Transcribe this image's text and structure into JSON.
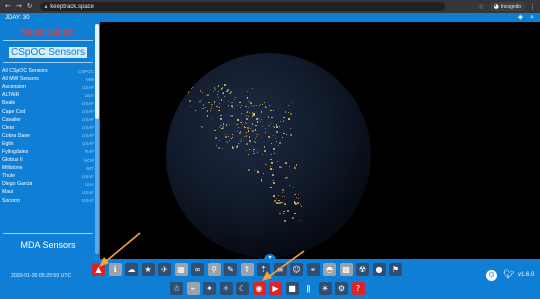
{
  "browser": {
    "url": "keeptrack.space",
    "incognito_label": "Incognito",
    "icons": {
      "back": "back-arrow-icon",
      "forward": "forward-arrow-icon",
      "reload": "reload-icon",
      "lock": "lock-icon",
      "bookmark": "star-icon",
      "incognito": "incognito-icon",
      "menu": "more-vert-icon"
    }
  },
  "topbar": {
    "jday": "JDAY: 30",
    "icons": [
      "layers-icon",
      "search-icon"
    ]
  },
  "panel": {
    "reset_label": "Reset Sensor",
    "cspoc_title": "CSpOC Sensors",
    "mda_title": "MDA Sensors",
    "sensors": [
      {
        "name": "All CSpOC Sensors",
        "code": "CSPOC"
      },
      {
        "name": "All MW Sensors",
        "code": "MW"
      },
      {
        "name": "Ascension",
        "code": "USAF"
      },
      {
        "name": "ALTAIR",
        "code": "USA"
      },
      {
        "name": "Beale",
        "code": "USAF"
      },
      {
        "name": "Cape Cod",
        "code": "USAF"
      },
      {
        "name": "Cavalier",
        "code": "USAF"
      },
      {
        "name": "Clear",
        "code": "USAF"
      },
      {
        "name": "Cobra Dane",
        "code": "USAF"
      },
      {
        "name": "Eglin",
        "code": "USAF"
      },
      {
        "name": "Fylingdales",
        "code": "RAF"
      },
      {
        "name": "Globus II",
        "code": "NOR"
      },
      {
        "name": "Millstone",
        "code": "MIT"
      },
      {
        "name": "Thule",
        "code": "USAF"
      },
      {
        "name": "Diego Garcia",
        "code": "USA"
      },
      {
        "name": "Maui",
        "code": "USAF"
      },
      {
        "name": "Socorro",
        "code": "USAF"
      }
    ]
  },
  "footer": {
    "datetime": "2020-01-30 05:20:59 UTC",
    "version": "v1.6.0",
    "toggle_icon": "chevron-down-icon",
    "row1_buttons": [
      {
        "name": "sensor-fov-button",
        "glyph": "▲",
        "style": "active"
      },
      {
        "name": "sensor-info-button",
        "glyph": "ℹ",
        "style": "gray"
      },
      {
        "name": "cloud-button",
        "glyph": "☁",
        "style": ""
      },
      {
        "name": "favorite-star-button",
        "glyph": "★",
        "style": ""
      },
      {
        "name": "satellite-view-button",
        "glyph": "✈",
        "style": ""
      },
      {
        "name": "map-button",
        "glyph": "▦",
        "style": "gray"
      },
      {
        "name": "orbit-button",
        "glyph": "∞",
        "style": ""
      },
      {
        "name": "satellite-button",
        "glyph": "⚲",
        "style": "gray"
      },
      {
        "name": "pencil-button",
        "glyph": "✎",
        "style": ""
      },
      {
        "name": "rocket-button",
        "glyph": "⇑",
        "style": "gray"
      },
      {
        "name": "missile-button",
        "glyph": "⇡",
        "style": ""
      },
      {
        "name": "timeline-button",
        "glyph": "≡",
        "style": ""
      },
      {
        "name": "person-button",
        "glyph": "☺",
        "style": ""
      },
      {
        "name": "constellation-button",
        "glyph": "⌖",
        "style": ""
      },
      {
        "name": "dome-button",
        "glyph": "◓",
        "style": "gray"
      },
      {
        "name": "sensor-grid-button",
        "glyph": "▩",
        "style": "gray"
      },
      {
        "name": "radiation-button",
        "glyph": "☢",
        "style": ""
      },
      {
        "name": "planets-button",
        "glyph": "●",
        "style": ""
      },
      {
        "name": "flag-button",
        "glyph": "⚑",
        "style": ""
      }
    ],
    "row2_buttons": [
      {
        "name": "astronaut-button",
        "glyph": "☃",
        "style": ""
      },
      {
        "name": "satellite-dish-button",
        "glyph": "⌁",
        "style": "gray"
      },
      {
        "name": "compass-button",
        "glyph": "✦",
        "style": ""
      },
      {
        "name": "camera-settings-button",
        "glyph": "✧",
        "style": ""
      },
      {
        "name": "night-mode-button",
        "glyph": "☾",
        "style": ""
      },
      {
        "name": "record-button",
        "glyph": "◉",
        "style": "active"
      },
      {
        "name": "video-button",
        "glyph": "▶",
        "style": "active"
      },
      {
        "name": "film-button",
        "glyph": "■",
        "style": ""
      },
      {
        "name": "thermometer-button",
        "glyph": "ǁ",
        "style": "plain"
      },
      {
        "name": "light-button",
        "glyph": "☀",
        "style": ""
      },
      {
        "name": "settings-button",
        "glyph": "⚙",
        "style": ""
      },
      {
        "name": "help-button",
        "glyph": "?",
        "style": "active"
      }
    ],
    "social_icons": [
      "github-icon",
      "twitter-icon"
    ]
  }
}
